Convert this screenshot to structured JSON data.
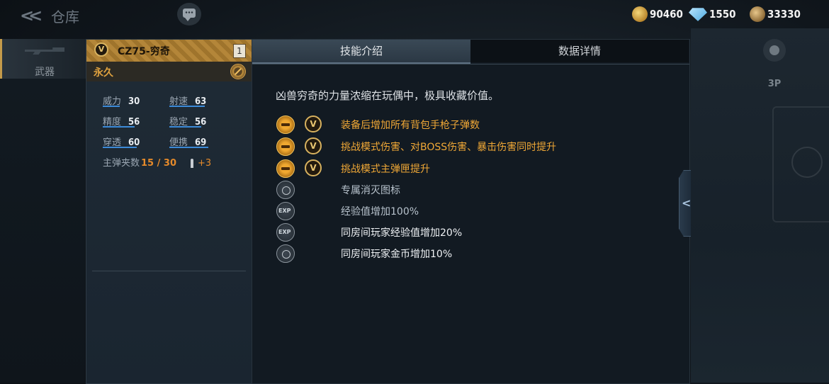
{
  "header": {
    "back_icon": "chevron-double-left-icon",
    "title": "仓库"
  },
  "currencies": [
    {
      "icon": "gold-coin-icon",
      "value": "90460"
    },
    {
      "icon": "diamond-icon",
      "value": "1550"
    },
    {
      "icon": "badge-coin-icon",
      "value": "33330"
    }
  ],
  "left_nav": {
    "weapons_label": "武器"
  },
  "side_nav": {
    "view_label": "3P"
  },
  "weapon": {
    "badge": "V",
    "name": "CZ75-穷奇",
    "count": "1",
    "duration": "永久",
    "stats": [
      {
        "key": "威力",
        "value": "30",
        "fill": 0.3
      },
      {
        "key": "射速",
        "value": "63",
        "fill": 0.63
      },
      {
        "key": "精度",
        "value": "56",
        "fill": 0.56
      },
      {
        "key": "稳定",
        "value": "56",
        "fill": 0.56
      },
      {
        "key": "穿透",
        "value": "60",
        "fill": 0.6
      },
      {
        "key": "便携",
        "value": "69",
        "fill": 0.69
      }
    ],
    "magazine_label": "主弹夹数",
    "magazine_value": "15 / 30",
    "magazine_bonus": "+3"
  },
  "tabs": {
    "skills": "技能介绍",
    "data": "数据详情"
  },
  "skills_panel": {
    "description": "凶兽穷奇的力量浓缩在玩偶中，极具收藏价值。",
    "items": [
      {
        "icon": "pistol-icon",
        "tier": "V",
        "text": "装备后增加所有背包手枪子弹数",
        "style": "gold"
      },
      {
        "icon": "damage-boost-icon",
        "tier": "V",
        "text": "挑战模式伤害、对BOSS伤害、暴击伤害同时提升",
        "style": "gold"
      },
      {
        "icon": "magazine-target-icon",
        "tier": "V",
        "text": "挑战模式主弹匣提升",
        "style": "gold"
      },
      {
        "icon": "kill-icon",
        "text": "专属消灭图标",
        "style": "dim"
      },
      {
        "icon": "exp-plus-icon",
        "text": "经验值增加100%",
        "style": "dim"
      },
      {
        "icon": "room-exp-icon",
        "text": "同房间玩家经验值增加20%",
        "style": "white"
      },
      {
        "icon": "room-coin-icon",
        "text": "同房间玩家金币增加10%",
        "style": "white"
      }
    ]
  }
}
